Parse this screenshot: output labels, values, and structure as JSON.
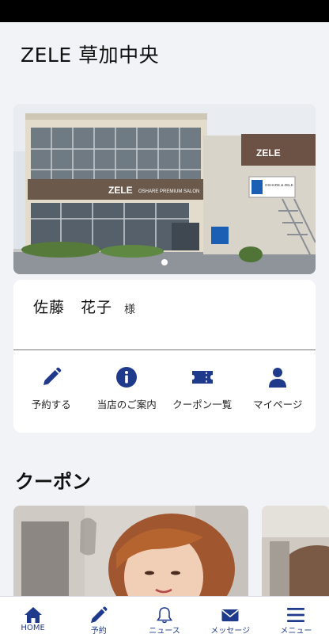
{
  "shop": {
    "title": "ZELE 草加中央"
  },
  "hero": {
    "sign_main": "ZELE",
    "sign_sub": "OSHARE PREMIUM SALON",
    "sign_side": "ZELE",
    "banner_text": "OSHARE & ZELE",
    "carousel": {
      "total": 1,
      "active": 1
    }
  },
  "customer": {
    "name": "佐藤　花子",
    "suffix": "様"
  },
  "quick_actions": [
    {
      "label": "予約する",
      "icon": "pencil-icon"
    },
    {
      "label": "当店のご案内",
      "icon": "info-icon"
    },
    {
      "label": "クーポン一覧",
      "icon": "ticket-icon"
    },
    {
      "label": "マイページ",
      "icon": "person-icon"
    }
  ],
  "sections": {
    "coupon_title": "クーポン"
  },
  "bottom_nav": [
    {
      "label": "HOME",
      "icon": "home-icon",
      "active": true
    },
    {
      "label": "予約",
      "icon": "pencil-icon",
      "active": false
    },
    {
      "label": "ニュース",
      "icon": "bell-icon",
      "active": false
    },
    {
      "label": "メッセージ",
      "icon": "mail-icon",
      "active": false
    },
    {
      "label": "メニュー",
      "icon": "menu-icon",
      "active": false
    }
  ],
  "colors": {
    "accent": "#1f3a8a",
    "background": "#f2f3f7",
    "card": "#ffffff"
  }
}
